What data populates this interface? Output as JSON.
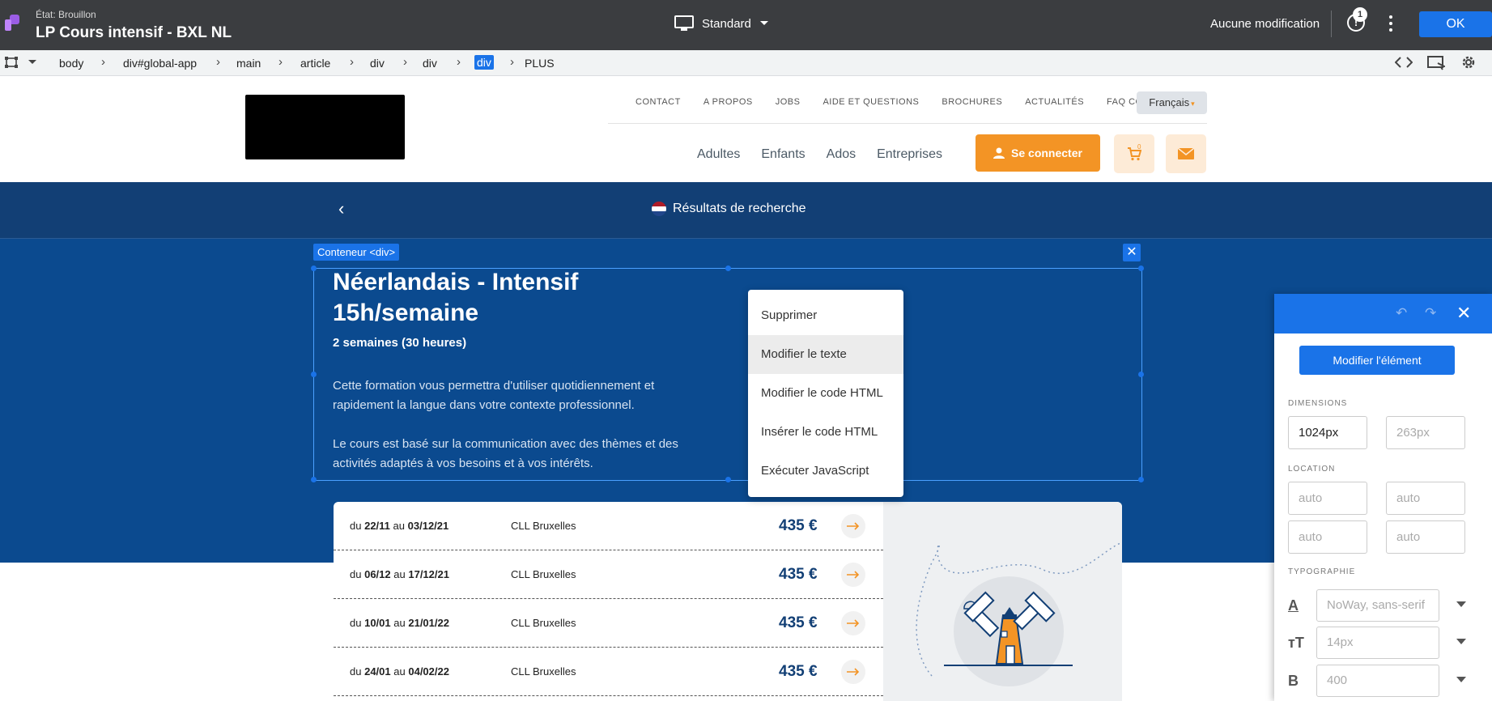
{
  "topbar": {
    "status": "État: Brouillon",
    "page_name": "LP Cours intensif - BXL NL",
    "device": "Standard",
    "modifications": "Aucune modification",
    "alert_count": "1",
    "ok": "OK"
  },
  "breadcrumb": {
    "items": [
      "body",
      "div#global-app",
      "main",
      "article",
      "div",
      "div",
      "div"
    ],
    "more": "PLUS"
  },
  "site": {
    "util_nav": [
      "CONTACT",
      "A PROPOS",
      "JOBS",
      "AIDE ET QUESTIONS",
      "BROCHURES",
      "ACTUALITÉS",
      "FAQ COVID-19"
    ],
    "language": "Français",
    "main_nav": [
      "Adultes",
      "Enfants",
      "Ados",
      "Entreprises"
    ],
    "connect": "Se connecter",
    "cart_count": "0",
    "search_results": "Résultats de recherche",
    "selection_label": "Conteneur <div>",
    "course": {
      "title": "Néerlandais - Intensif 15h/semaine",
      "subtitle": "2 semaines (30 heures)",
      "desc1": "Cette formation vous permettra d'utiliser quotidiennement et rapidement la langue dans votre contexte professionnel.",
      "desc2": "Le cours est basé sur la communication avec des thèmes et des activités adaptés à vos besoins et à vos intérêts."
    },
    "sessions": [
      {
        "du": "du",
        "start": "22/11",
        "au": "au",
        "end": "03/12/21",
        "location": "CLL Bruxelles",
        "price": "435 €"
      },
      {
        "du": "du",
        "start": "06/12",
        "au": "au",
        "end": "17/12/21",
        "location": "CLL Bruxelles",
        "price": "435 €"
      },
      {
        "du": "du",
        "start": "10/01",
        "au": "au",
        "end": "21/01/22",
        "location": "CLL Bruxelles",
        "price": "435 €"
      },
      {
        "du": "du",
        "start": "24/01",
        "au": "au",
        "end": "04/02/22",
        "location": "CLL Bruxelles",
        "price": "435 €"
      }
    ]
  },
  "context_menu": {
    "items": [
      "Supprimer",
      "Modifier le texte",
      "Modifier le code HTML",
      "Insérer le code HTML",
      "Exécuter JavaScript"
    ]
  },
  "panel": {
    "edit_element": "Modifier l'élément",
    "dimensions_label": "DIMENSIONS",
    "width_value": "1024px",
    "height_placeholder": "263px",
    "location_label": "LOCATION",
    "loc_top": "auto",
    "loc_right": "auto",
    "loc_bottom": "auto",
    "loc_left": "auto",
    "typography_label": "TYPOGRAPHIE",
    "font_family": "NoWay, sans-serif",
    "font_size": "14px",
    "font_weight": "400"
  },
  "colors": {
    "editor_dark": "#3b3d40",
    "accent_blue": "#1a73e8",
    "site_navy": "#123f75",
    "hero_blue": "#0b4a8f",
    "orange": "#f39425"
  }
}
